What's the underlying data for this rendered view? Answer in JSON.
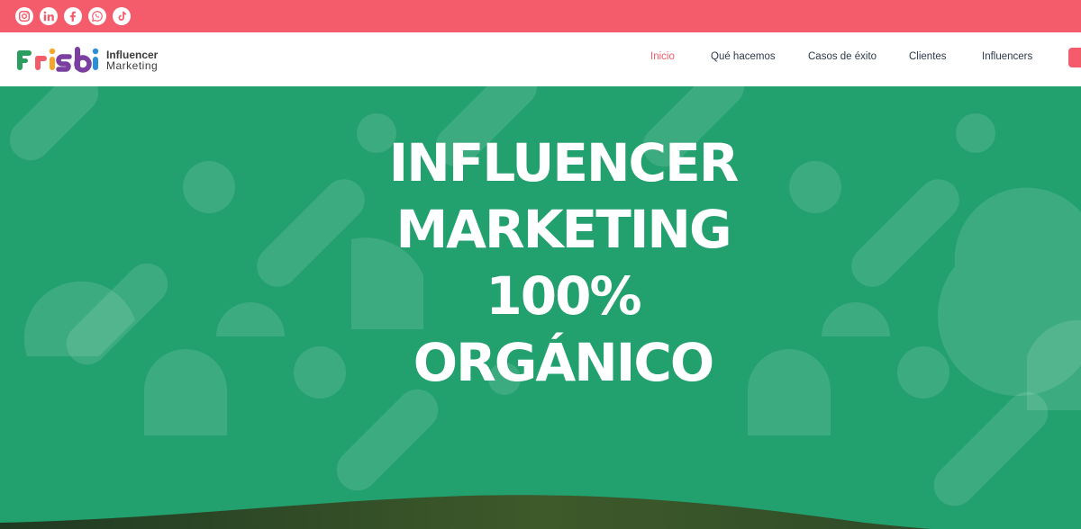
{
  "social": {
    "icons": [
      "instagram-icon",
      "linkedin-icon",
      "facebook-icon",
      "whatsapp-icon",
      "tiktok-icon"
    ]
  },
  "brand": {
    "name": "Frisbi",
    "tagline_line1": "Influencer",
    "tagline_line2": "Marketing",
    "colors": [
      "#2a9d5f",
      "#f45b6b",
      "#f4a62a",
      "#7a3fa0",
      "#2a8fd6"
    ]
  },
  "nav": {
    "items": [
      {
        "label": "Inicio",
        "active": true
      },
      {
        "label": "Qué hacemos",
        "active": false
      },
      {
        "label": "Casos de éxito",
        "active": false
      },
      {
        "label": "Clientes",
        "active": false
      },
      {
        "label": "Influencers",
        "active": false
      }
    ]
  },
  "hero": {
    "line1": "INFLUENCER",
    "line2": "MARKETING",
    "line3": "100%",
    "line4": "ORGÁNICO"
  },
  "colors": {
    "topbar": "#f45b6b",
    "hero_bg": "#22a06e",
    "nav_active": "#f45b6b",
    "nav_text": "#2d3a4a"
  }
}
